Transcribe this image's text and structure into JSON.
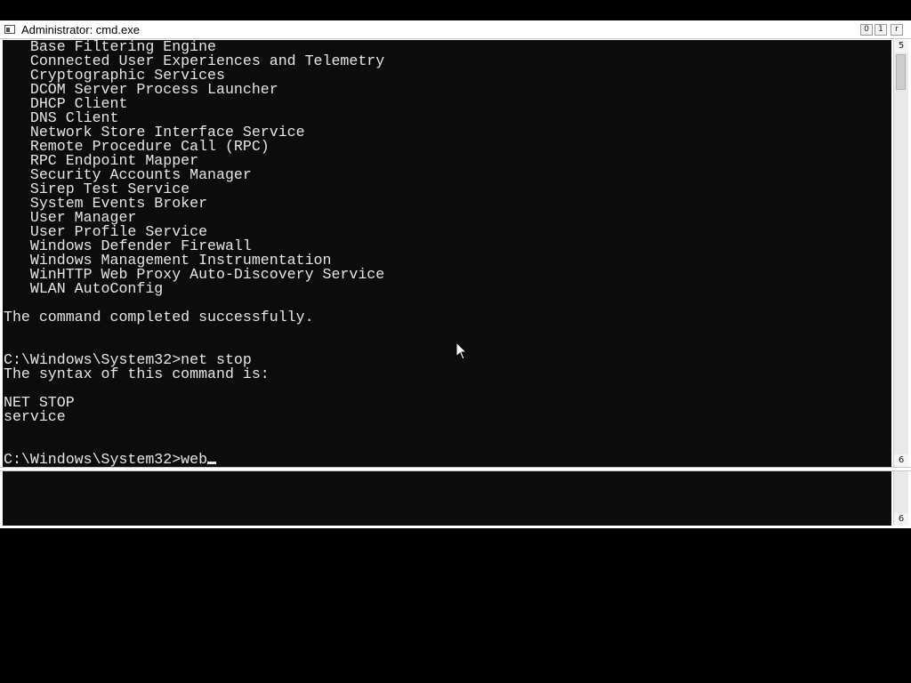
{
  "window": {
    "title": "Administrator: cmd.exe",
    "minimize_glyph": "0",
    "maximize_glyph": "1",
    "close_glyph": "r"
  },
  "console": {
    "lines": [
      "   Base Filtering Engine",
      "   Connected User Experiences and Telemetry",
      "   Cryptographic Services",
      "   DCOM Server Process Launcher",
      "   DHCP Client",
      "   DNS Client",
      "   Network Store Interface Service",
      "   Remote Procedure Call (RPC)",
      "   RPC Endpoint Mapper",
      "   Security Accounts Manager",
      "   Sirep Test Service",
      "   System Events Broker",
      "   User Manager",
      "   User Profile Service",
      "   Windows Defender Firewall",
      "   Windows Management Instrumentation",
      "   WinHTTP Web Proxy Auto-Discovery Service",
      "   WLAN AutoConfig",
      "",
      "The command completed successfully.",
      "",
      "",
      "C:\\Windows\\System32>net stop",
      "The syntax of this command is:",
      "",
      "NET STOP",
      "service",
      "",
      "",
      "C:\\Windows\\System32>web"
    ]
  },
  "scrollbars": {
    "upper_up_glyph": "5",
    "upper_down_glyph": "6",
    "lower_down_glyph": "6"
  },
  "colors": {
    "console_background": "#0c0c0c",
    "console_text": "#e6e6e6",
    "chrome": "#ffffff"
  }
}
